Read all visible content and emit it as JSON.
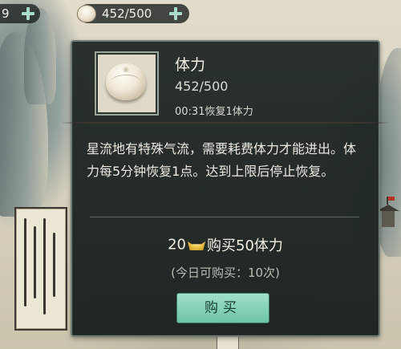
{
  "top_bar": {
    "left_resource_value": "9",
    "stamina_value": "452/500"
  },
  "tooltip": {
    "item_name": "体力",
    "item_value": "452/500",
    "recovery_timer": "00:31恢复1体力",
    "description": "星流地有特殊气流，需要耗费体力才能进出。体力每5分钟恢复1点。达到上限后停止恢复。",
    "purchase": {
      "cost": "20",
      "currency_icon": "gold-ingot-icon",
      "label": "购买50体力",
      "daily_limit": "(今日可购买：10次)",
      "button_label": "购买"
    }
  },
  "colors": {
    "panel_bg": "#222a28",
    "panel_border": "#6f7c74",
    "button_bg": "#8fd6bb",
    "plus_icon": "#a9dcc6"
  }
}
